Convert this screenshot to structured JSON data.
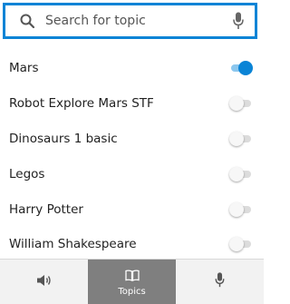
{
  "search": {
    "placeholder": "Search for topic",
    "value": ""
  },
  "topics": [
    {
      "label": "Mars",
      "enabled": true
    },
    {
      "label": "Robot Explore Mars STF",
      "enabled": false
    },
    {
      "label": "Dinosaurs 1 basic",
      "enabled": false
    },
    {
      "label": "Legos",
      "enabled": false
    },
    {
      "label": "Harry Potter",
      "enabled": false
    },
    {
      "label": "William Shakespeare",
      "enabled": false
    }
  ],
  "tabs": [
    {
      "id": "sound",
      "label": "",
      "icon": "speaker-icon",
      "active": false
    },
    {
      "id": "topics",
      "label": "Topics",
      "icon": "book-icon",
      "active": true
    },
    {
      "id": "mic",
      "label": "",
      "icon": "microphone-icon",
      "active": false
    }
  ],
  "colors": {
    "accent": "#0a84d6",
    "active_tab": "#7f7f7f"
  }
}
